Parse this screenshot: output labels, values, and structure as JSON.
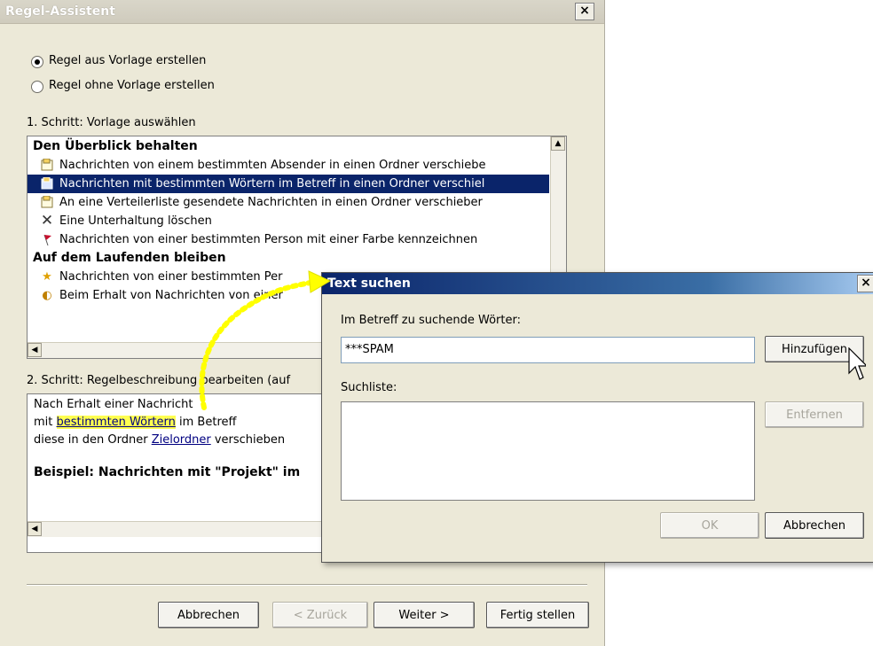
{
  "wizard": {
    "title": "Regel-Assistent",
    "close_label": "×",
    "radio_from_template": "Regel aus Vorlage erstellen",
    "radio_blank": "Regel ohne Vorlage erstellen",
    "step1_label": "1. Schritt: Vorlage auswählen",
    "groups": [
      {
        "name": "Den Überblick behalten",
        "items": [
          {
            "icon": "move-to-folder-icon",
            "label": "Nachrichten von einem bestimmten Absender in einen Ordner verschiebe"
          },
          {
            "icon": "move-to-folder-icon",
            "label": "Nachrichten mit bestimmten Wörtern im Betreff in einen Ordner verschiel",
            "selected": true
          },
          {
            "icon": "move-to-folder-icon",
            "label": "An eine Verteilerliste gesendete Nachrichten in einen Ordner verschieber"
          },
          {
            "icon": "delete-x-icon",
            "label": "Eine Unterhaltung löschen"
          },
          {
            "icon": "flag-icon",
            "label": "Nachrichten von einer bestimmten Person mit einer Farbe kennzeichnen"
          }
        ]
      },
      {
        "name": "Auf dem Laufenden bleiben",
        "items": [
          {
            "icon": "alert-star-icon",
            "label": "Nachrichten von einer bestimmten Per"
          },
          {
            "icon": "sound-icon",
            "label": "Beim Erhalt von Nachrichten von einer"
          }
        ]
      }
    ],
    "step2_label": "2. Schritt: Regelbeschreibung bearbeiten (auf",
    "desc_line1": "Nach Erhalt einer Nachricht",
    "desc_line2_prefix": "mit ",
    "desc_line2_link": "bestimmten Wörtern",
    "desc_line2_suffix": " im Betreff",
    "desc_line3_prefix": "diese in den Ordner ",
    "desc_line3_link": "Zielordner",
    "desc_line3_suffix": " verschieben",
    "example": "Beispiel: Nachrichten mit \"Projekt\" im",
    "buttons": {
      "cancel": "Abbrechen",
      "back": "< Zurück",
      "next": "Weiter >",
      "finish": "Fertig stellen"
    }
  },
  "dialog": {
    "title": "Text suchen",
    "close_label": "×",
    "words_label": "Im Betreff zu suchende Wörter:",
    "words_value": "***SPAM",
    "add_button": "Hinzufügen",
    "list_label": "Suchliste:",
    "remove_button": "Entfernen",
    "ok_button": "OK",
    "cancel_button": "Abbrechen"
  },
  "colors": {
    "selection": "#0a246a",
    "highlight": "#ffff50",
    "link": "#000080",
    "arrow": "#ffff00"
  }
}
